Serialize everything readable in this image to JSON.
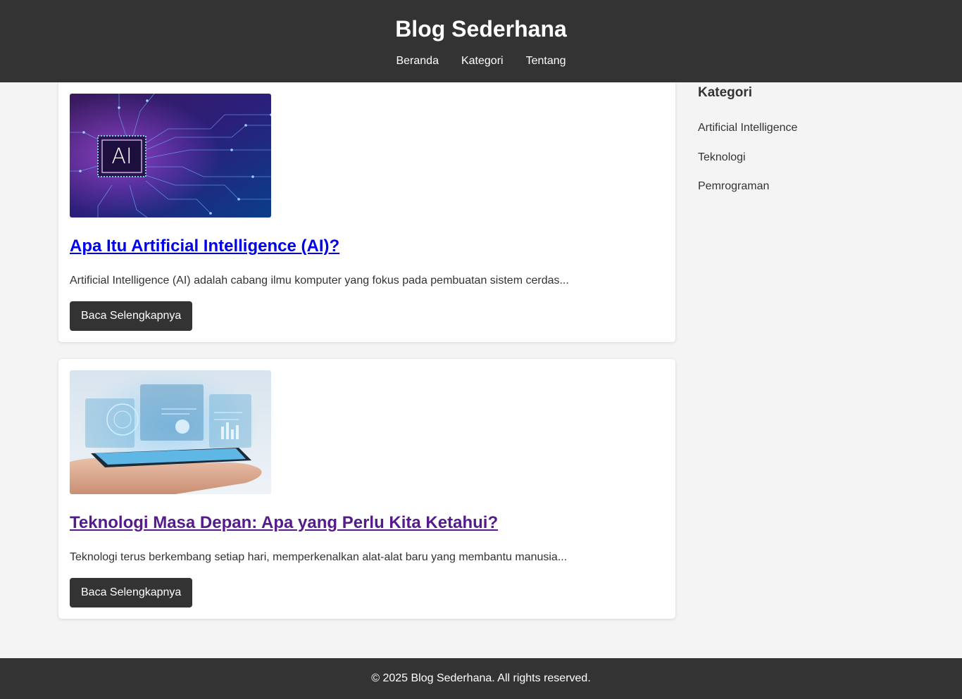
{
  "header": {
    "title": "Blog Sederhana",
    "nav": [
      "Beranda",
      "Kategori",
      "Tentang"
    ]
  },
  "posts": [
    {
      "image_icon": "ai-chip-image",
      "image_text": "AI",
      "title": "Apa Itu Artificial Intelligence (AI)?",
      "excerpt": "Artificial Intelligence (AI) adalah cabang ilmu komputer yang fokus pada pembuatan sistem cerdas...",
      "button": "Baca Selengkapnya"
    },
    {
      "image_icon": "tablet-hologram-image",
      "title": "Teknologi Masa Depan: Apa yang Perlu Kita Ketahui?",
      "excerpt": "Teknologi terus berkembang setiap hari, memperkenalkan alat-alat baru yang membantu manusia...",
      "button": "Baca Selengkapnya"
    }
  ],
  "sidebar": {
    "title": "Kategori",
    "items": [
      "Artificial Intelligence",
      "Teknologi",
      "Pemrograman"
    ]
  },
  "footer": {
    "text": "© 2025 Blog Sederhana. All rights reserved."
  },
  "colors": {
    "header_bg": "#333333",
    "page_bg": "#f4f4f4",
    "link_unvisited": "#0000ee",
    "link_visited": "#551a8b",
    "button_bg": "#333333"
  }
}
